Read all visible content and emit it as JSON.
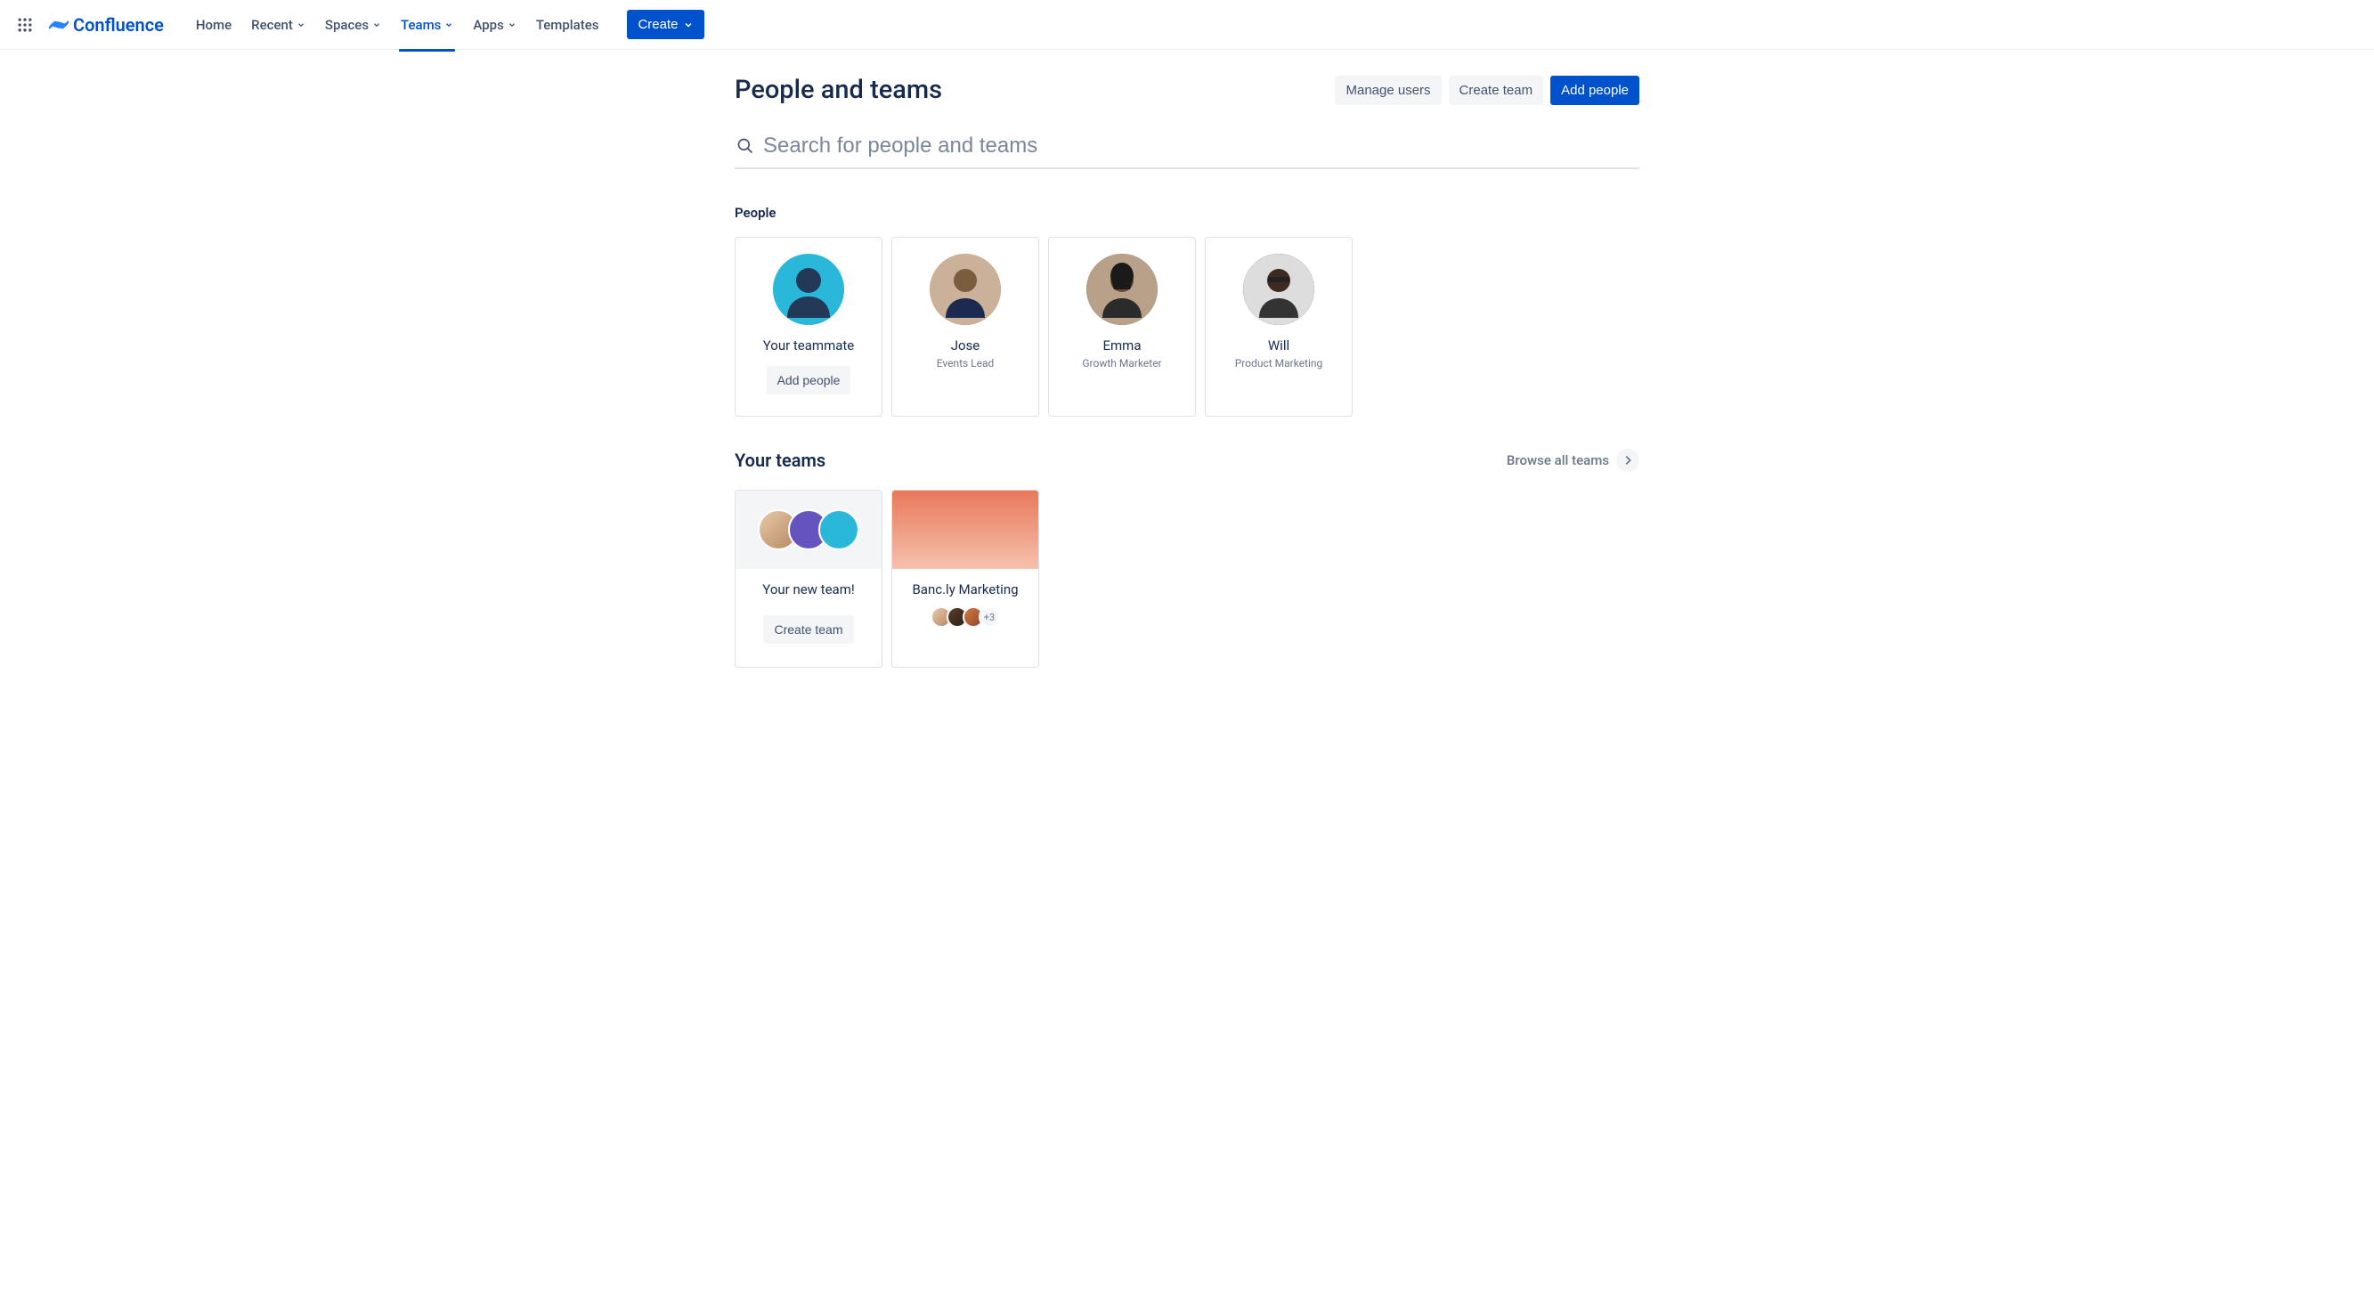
{
  "nav": {
    "product": "Confluence",
    "items": [
      {
        "label": "Home",
        "dropdown": false,
        "active": false
      },
      {
        "label": "Recent",
        "dropdown": true,
        "active": false
      },
      {
        "label": "Spaces",
        "dropdown": true,
        "active": false
      },
      {
        "label": "Teams",
        "dropdown": true,
        "active": true
      },
      {
        "label": "Apps",
        "dropdown": true,
        "active": false
      },
      {
        "label": "Templates",
        "dropdown": false,
        "active": false
      }
    ],
    "create": "Create"
  },
  "page": {
    "title": "People and teams",
    "actions": {
      "manage_users": "Manage users",
      "create_team": "Create team",
      "add_people": "Add people"
    }
  },
  "search": {
    "placeholder": "Search for people and teams"
  },
  "people": {
    "heading": "People",
    "cards": [
      {
        "name": "Your teammate",
        "role": "",
        "cta": "Add people",
        "placeholder": true
      },
      {
        "name": "Jose",
        "role": "Events Lead"
      },
      {
        "name": "Emma",
        "role": "Growth Marketer"
      },
      {
        "name": "Will",
        "role": "Product Marketing"
      }
    ]
  },
  "teams": {
    "heading": "Your teams",
    "browse": "Browse all teams",
    "cards": [
      {
        "name": "Your new team!",
        "cta": "Create team",
        "placeholder": true
      },
      {
        "name": "Banc.ly Marketing",
        "extra_count": "+3"
      }
    ]
  }
}
